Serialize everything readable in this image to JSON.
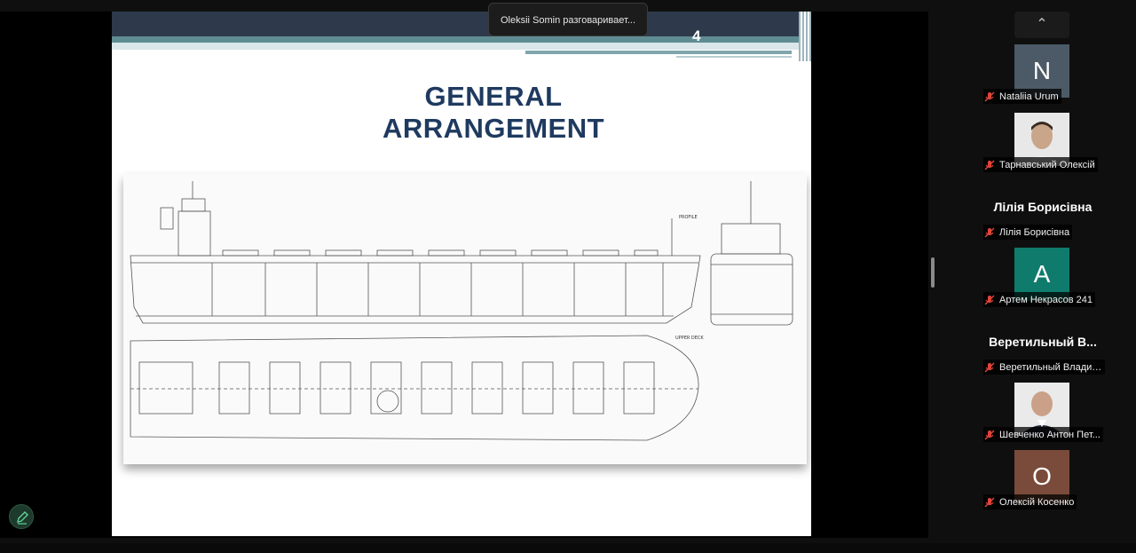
{
  "toast": {
    "text": "Oleksii Somin разговаривает..."
  },
  "slide": {
    "number": "4",
    "title_line1": "GENERAL",
    "title_line2": "ARRANGEMENT",
    "drawing_labels": {
      "profile": "PROFILE",
      "upper_deck": "UPPER DECK"
    }
  },
  "panel": {
    "up_arrow": "⌃",
    "participants": [
      {
        "name": "Nataliia Urum",
        "avatar_letter": "N",
        "avatar_color": "#4b5a66"
      },
      {
        "name": "Тарнавський Олексій",
        "avatar_letter": "",
        "avatar_color": "#d9d9d9"
      },
      {
        "big_name": "Лілія Борисівна",
        "name": "Лілія Борисівна"
      },
      {
        "name": "Артем Некрасов 241",
        "avatar_letter": "A",
        "avatar_color": "#0f7b6c"
      },
      {
        "big_name": "Веретильный В...",
        "name": "Веретильный Владисл..."
      },
      {
        "name": "Шевченко Антон Пет...",
        "avatar_letter": "",
        "avatar_color": "#d9d9d9"
      },
      {
        "name": "Олексій Косенко",
        "avatar_letter": "O",
        "avatar_color": "#7a4b3a"
      }
    ]
  },
  "colors": {
    "mic_muted": "#e0453a",
    "title": "#1f3a5f"
  }
}
